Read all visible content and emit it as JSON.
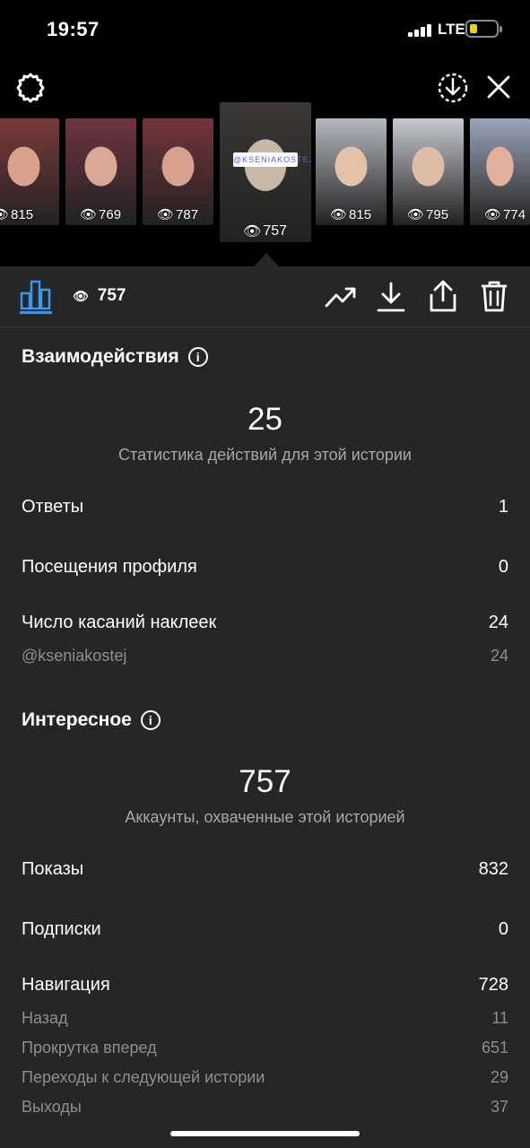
{
  "status_bar": {
    "time": "19:57",
    "network": "LTE"
  },
  "thumbnails": [
    {
      "views": "815",
      "bg": "#7a3a3a",
      "face": "#d8a28f"
    },
    {
      "views": "769",
      "bg": "#6e3540",
      "face": "#d9a896"
    },
    {
      "views": "787",
      "bg": "#73343a",
      "face": "#d6a18e"
    },
    {
      "views": "757",
      "bg": "#3b3836",
      "face": "#c8b8a8",
      "sticker": "@KSENIAKOSTEJ"
    },
    {
      "views": "815",
      "bg": "#b4b8c0",
      "face": "#e2c2a8"
    },
    {
      "views": "795",
      "bg": "#c7c9d1",
      "face": "#dcbca4"
    },
    {
      "views": "774",
      "bg": "#9aa4b8",
      "face": "#e0b09c"
    }
  ],
  "toolbar": {
    "views": "757"
  },
  "interactions": {
    "title": "Взаимодействия",
    "total": "25",
    "subtitle": "Статистика действий для этой истории",
    "rows": [
      {
        "label": "Ответы",
        "value": "1"
      },
      {
        "label": "Посещения профиля",
        "value": "0"
      },
      {
        "label": "Число касаний наклеек",
        "value": "24"
      },
      {
        "label": "@kseniakostej",
        "value": "24"
      }
    ]
  },
  "discovery": {
    "title": "Интересное",
    "total": "757",
    "subtitle": "Аккаунты, охваченные этой историей",
    "rows": [
      {
        "label": "Показы",
        "value": "832"
      },
      {
        "label": "Подписки",
        "value": "0"
      },
      {
        "label": "Навигация",
        "value": "728"
      },
      {
        "label": "Назад",
        "value": "11"
      },
      {
        "label": "Прокрутка вперед",
        "value": "651"
      },
      {
        "label": "Переходы к следующей истории",
        "value": "29"
      },
      {
        "label": "Выходы",
        "value": "37"
      }
    ]
  },
  "colors": {
    "accent": "#3897f0",
    "background": "#262626",
    "muted": "#8e8e8e"
  }
}
